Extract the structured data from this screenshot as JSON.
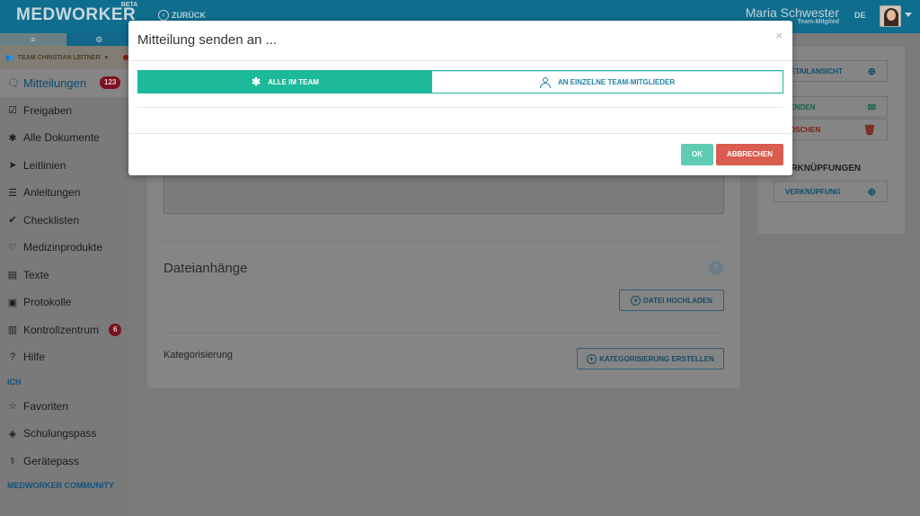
{
  "header": {
    "logo": "MEDWORKER",
    "beta": "BETA",
    "back_label": "ZURÜCK",
    "user_name": "Maria Schwester",
    "user_role": "Team-Mitglied",
    "language": "DE"
  },
  "sidebar": {
    "tabs": [
      "≡",
      "⚙"
    ],
    "team": "TEAM CHRISTIAN LEITNER",
    "items": [
      {
        "label": "Mitteilungen",
        "icon": "chat-icon",
        "badge": "123"
      },
      {
        "label": "Freigaben",
        "icon": "check-square-icon"
      },
      {
        "label": "Alle Dokumente",
        "icon": "asterisk-icon"
      },
      {
        "label": "Leitlinien",
        "icon": "send-icon"
      },
      {
        "label": "Anleitungen",
        "icon": "list-icon"
      },
      {
        "label": "Checklisten",
        "icon": "check-circle-icon"
      },
      {
        "label": "Medizinprodukte",
        "icon": "heart-pulse-icon"
      },
      {
        "label": "Texte",
        "icon": "book-icon"
      },
      {
        "label": "Protokolle",
        "icon": "clipboard-icon"
      },
      {
        "label": "Kontrollzentrum",
        "icon": "bar-chart-icon",
        "badge": "6"
      },
      {
        "label": "Hilfe",
        "icon": "question-icon"
      }
    ],
    "section_me": "ICH",
    "me_items": [
      {
        "label": "Favoriten",
        "icon": "star-icon"
      },
      {
        "label": "Schulungspass",
        "icon": "graduation-cap-icon"
      },
      {
        "label": "Gerätepass",
        "icon": "stethoscope-icon"
      }
    ],
    "section_community": "MEDWORKER COMMUNITY"
  },
  "content": {
    "attachments_heading": "Dateianhänge",
    "upload_button": "DATEI HOCHLADEN",
    "category_label": "Kategorisierung",
    "category_button": "KATEGORISIERUNG ERSTELLEN"
  },
  "right_panel": {
    "detail_view": "DETAILANSICHT",
    "send": "SENDEN",
    "delete": "LÖSCHEN",
    "links_heading": "VERKNÜPFUNGEN",
    "link_button": "VERKNÜPFUNG"
  },
  "modal": {
    "title": "Mitteilung senden an ...",
    "close": "×",
    "option_all": "ALLE IM TEAM",
    "option_individual": "AN EINZELNE TEAM-MITGLIEDER",
    "ok": "OK",
    "cancel": "ABBRECHEN"
  },
  "colors": {
    "primary": "#0f6d8e",
    "teal": "#1cb99a",
    "danger": "#d95c4f",
    "badge": "#7b1020"
  }
}
